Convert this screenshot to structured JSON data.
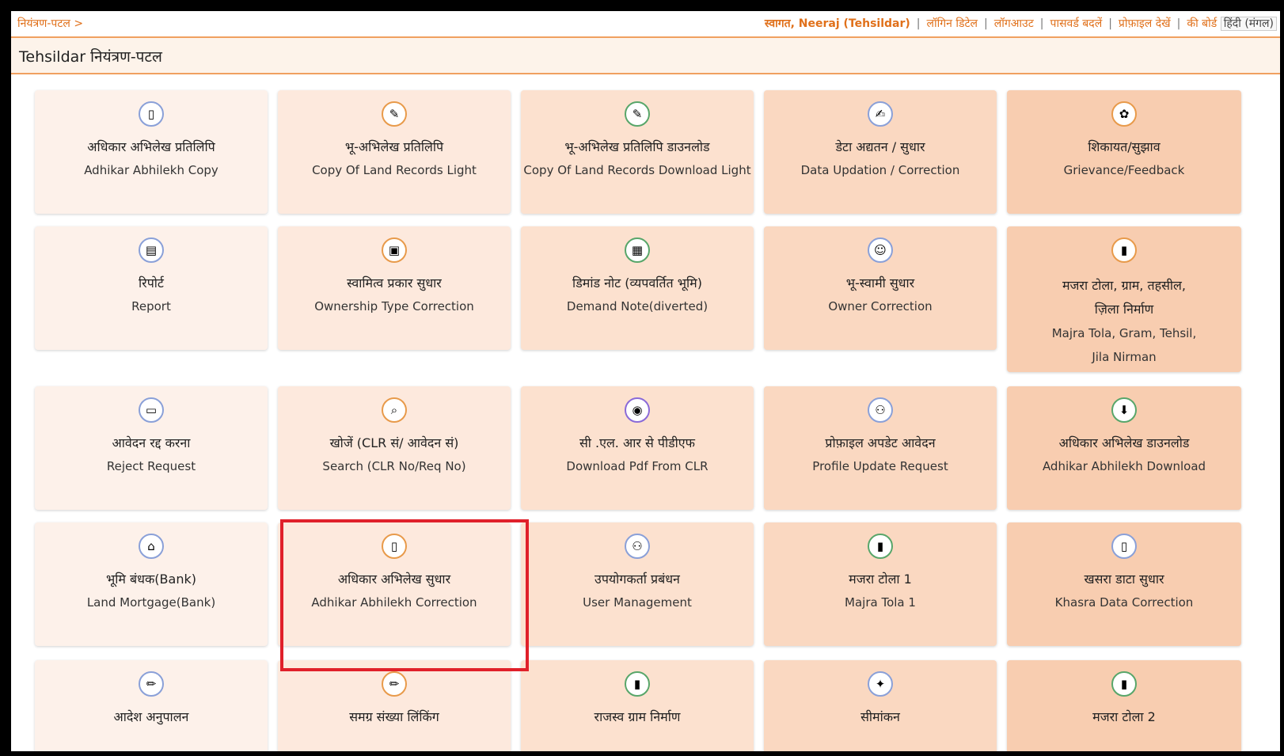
{
  "breadcrumb": "नियंत्रण-पटल >",
  "toplinks": {
    "welcome": "स्वागत, Neeraj (Tehsildar)",
    "login_details": "लॉगिन डिटेल",
    "logout": "लॉगआउट",
    "change_password": "पासवर्ड बदलें",
    "view_profile": "प्रोफ़ाइल देखें",
    "keyboard": "की बोर्ड",
    "language": "हिंदी (मंगल)"
  },
  "page_title": "Tehsildar नियंत्रण-पटल",
  "tiles": {
    "adhikar_copy": {
      "hi": "अधिकार अभिलेख प्रतिलिपि",
      "en": "Adhikar Abhilekh Copy",
      "icon": "document-icon"
    },
    "land_copy_light": {
      "hi": "भू-अभिलेख प्रतिलिपि",
      "en": "Copy Of Land Records Light",
      "icon": "pen-paper-icon"
    },
    "land_copy_download": {
      "hi": "भू-अभिलेख प्रतिलिपि डाउनलोड",
      "en": "Copy Of Land Records Download Light",
      "icon": "pen-paper-icon"
    },
    "data_update": {
      "hi": "डेटा अद्यतन / सुधार",
      "en": "Data Updation / Correction",
      "icon": "edit-icon"
    },
    "grievance": {
      "hi": "शिकायत/सुझाव",
      "en": "Grievance/Feedback",
      "icon": "feedback-icon"
    },
    "report": {
      "hi": "रिपोर्ट",
      "en": "Report",
      "icon": "report-icon"
    },
    "ownership_type": {
      "hi": "स्वामित्व प्रकार सुधार",
      "en": "Ownership Type Correction",
      "icon": "clipboard-icon"
    },
    "demand_note": {
      "hi": "डिमांड नोट (व्यपवर्तित भूमि)",
      "en": "Demand Note(diverted)",
      "icon": "note-icon"
    },
    "owner_correction": {
      "hi": "भू-स्वामी सुधार",
      "en": "Owner Correction",
      "icon": "owner-icon"
    },
    "majra_nirman": {
      "hi_line1": "मजरा टोला, ग्राम, तहसील,",
      "hi_line2": "ज़िला निर्माण",
      "en_line1": "Majra Tola, Gram, Tehsil,",
      "en_line2": "Jila Nirman",
      "icon": "book-icon"
    },
    "reject_request": {
      "hi": "आवेदन रद्द करना",
      "en": "Reject Request",
      "icon": "reject-icon"
    },
    "search": {
      "hi": "खोजें (CLR सं/ आवेदन सं)",
      "en": "Search (CLR No/Req No)",
      "icon": "search-icon"
    },
    "pdf_clr": {
      "hi": "सी .एल. आर से पीडीएफ",
      "en": "Download Pdf From CLR",
      "icon": "pdf-icon"
    },
    "profile_update": {
      "hi": "प्रोफ़ाइल अपडेट आवेदन",
      "en": "Profile Update Request",
      "icon": "users-icon"
    },
    "adhikar_download": {
      "hi": "अधिकार अभिलेख डाउनलोड",
      "en": "Adhikar Abhilekh Download",
      "icon": "download-icon"
    },
    "land_mortgage": {
      "hi": "भूमि बंधक(Bank)",
      "en": "Land Mortgage(Bank)",
      "icon": "bank-icon"
    },
    "adhikar_correction": {
      "hi": "अधिकार अभिलेख सुधार",
      "en": "Adhikar Abhilekh Correction",
      "icon": "document-icon"
    },
    "user_management": {
      "hi": "उपयोगकर्ता प्रबंधन",
      "en": "User Management",
      "icon": "users-icon"
    },
    "majra_tola_1": {
      "hi": "मजरा टोला 1",
      "en": "Majra Tola 1",
      "icon": "book-icon"
    },
    "khasra_correction": {
      "hi": "खसरा डाटा सुधार",
      "en": "Khasra Data Correction",
      "icon": "document-icon"
    },
    "order_compliance": {
      "hi": "आदेश अनुपालन",
      "icon": "pencil-icon"
    },
    "samagra_linking": {
      "hi": "समग्र संख्या लिंकिंग",
      "icon": "pencil-icon"
    },
    "revenue_village": {
      "hi": "राजस्व ग्राम निर्माण",
      "icon": "book-icon"
    },
    "demarcation": {
      "hi": "सीमांकन",
      "icon": "compass-icon"
    },
    "majra_tola_2": {
      "hi": "मजरा टोला 2",
      "icon": "book-icon"
    }
  }
}
